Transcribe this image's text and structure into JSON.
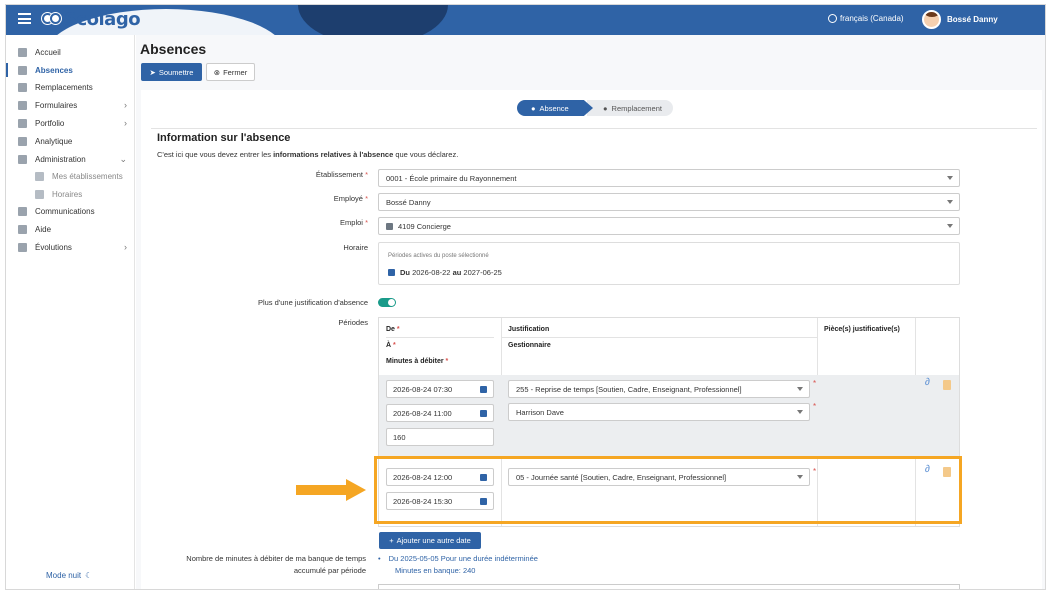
{
  "header": {
    "brand": "Scolago",
    "language": "français (Canada)",
    "user_name": "Bossé Danny"
  },
  "sidebar": {
    "items": [
      {
        "label": "Accueil",
        "icon": "home-icon"
      },
      {
        "label": "Absences",
        "icon": "absence-icon",
        "active": true
      },
      {
        "label": "Remplacements",
        "icon": "replacement-icon"
      },
      {
        "label": "Formulaires",
        "icon": "forms-icon",
        "chevron": "›"
      },
      {
        "label": "Portfolio",
        "icon": "trophy-icon",
        "chevron": "›"
      },
      {
        "label": "Analytique",
        "icon": "analytics-icon"
      },
      {
        "label": "Administration",
        "icon": "gear-icon",
        "chevron": "⌄"
      },
      {
        "label": "Mes établissements",
        "icon": "building-icon",
        "sub": true
      },
      {
        "label": "Horaires",
        "icon": "schedule-icon",
        "sub": true
      },
      {
        "label": "Communications",
        "icon": "megaphone-icon"
      },
      {
        "label": "Aide",
        "icon": "help-icon"
      },
      {
        "label": "Évolutions",
        "icon": "evolution-icon",
        "chevron": "›"
      }
    ],
    "night_mode": "Mode nuit"
  },
  "page": {
    "title": "Absences",
    "submit_label": "Soumettre",
    "close_label": "Fermer"
  },
  "stepper": {
    "step1": "Absence",
    "step2": "Remplacement"
  },
  "section": {
    "title": "Information sur l'absence",
    "desc_prefix": "C'est ici que vous devez entrer les ",
    "desc_bold": "informations relatives à l'absence",
    "desc_suffix": " que vous déclarez."
  },
  "form": {
    "etablissement_label": "Établissement",
    "etablissement_value": "0001 - École primaire du Rayonnement",
    "employe_label": "Employé",
    "employe_value": "Bossé Danny",
    "emploi_label": "Emploi",
    "emploi_value": "4109 Concierge",
    "horaire_label": "Horaire",
    "horaire_note": "Périodes actives du poste sélectionné",
    "horaire_du": "Du",
    "horaire_start": "2026-08-22",
    "horaire_au": "au",
    "horaire_end": "2027-06-25",
    "plus_justif_label": "Plus d'une justification d'absence",
    "periodes_label": "Périodes",
    "required_mark": "*"
  },
  "periods_table": {
    "col_de": "De",
    "col_a": "À",
    "col_minutes": "Minutes à débiter",
    "col_justification": "Justification",
    "col_gestionnaire": "Gestionnaire",
    "col_pieces": "Pièce(s) justificative(s)",
    "rows": [
      {
        "de": "2026-08-24 07:30",
        "a": "2026-08-24 11:00",
        "minutes": "160",
        "justification": "255 - Reprise de temps [Soutien, Cadre, Enseignant, Professionnel]",
        "gestionnaire": "Harrison Dave"
      },
      {
        "de": "2026-08-24 12:00",
        "a": "2026-08-24 15:30",
        "justification": "05 - Journée santé [Soutien, Cadre, Enseignant, Professionnel]"
      }
    ],
    "add_label": "Ajouter une autre date"
  },
  "bank": {
    "label_line1": "Nombre de minutes à débiter de ma banque de temps",
    "label_line2": "accumulé par période",
    "value_line1": "Du 2025-05-05 Pour une durée indéterminée",
    "value_line2": "Minutes en banque: 240"
  },
  "colors": {
    "primary": "#2f63a6",
    "highlight": "#f5a623",
    "toggle_on": "#1a9b8a"
  }
}
